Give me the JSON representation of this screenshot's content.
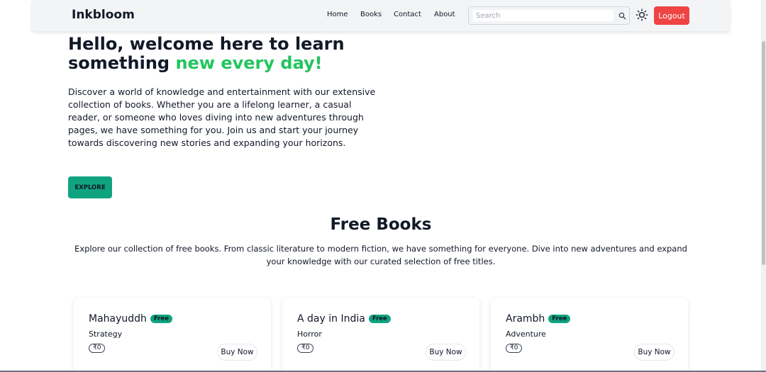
{
  "navbar": {
    "brand": "Inkbloom",
    "links": [
      "Home",
      "Books",
      "Contact",
      "About"
    ],
    "search_placeholder": "Search",
    "logout_label": "Logout"
  },
  "hero": {
    "title_part1": "Hello, welcome here to learn something ",
    "title_accent": "new every day!",
    "description": "Discover a world of knowledge and entertainment with our extensive collection of books. Whether you are a lifelong learner, a casual reader, or someone who loves diving into new adventures through pages, we have something for you. Join us and start your journey towards discovering new stories and expanding your horizons.",
    "explore_label": "EXPLORE"
  },
  "free_books": {
    "title": "Free Books",
    "description": "Explore our collection of free books. From classic literature to modern fiction, we have something for everyone. Dive into new adventures and expand your knowledge with our curated selection of free titles.",
    "cards": [
      {
        "title": "Mahayuddh",
        "badge": "Free",
        "category": "Strategy",
        "price": "₹0",
        "buy_label": "Buy Now"
      },
      {
        "title": "A day in India",
        "badge": "Free",
        "category": "Horror",
        "price": "₹0",
        "buy_label": "Buy Now"
      },
      {
        "title": "Arambh",
        "badge": "Free",
        "category": "Adventure",
        "price": "₹0",
        "buy_label": "Buy Now"
      }
    ]
  },
  "colors": {
    "accent_green": "#22c55e",
    "primary_button": "#10a37f",
    "logout": "#ef4444"
  }
}
